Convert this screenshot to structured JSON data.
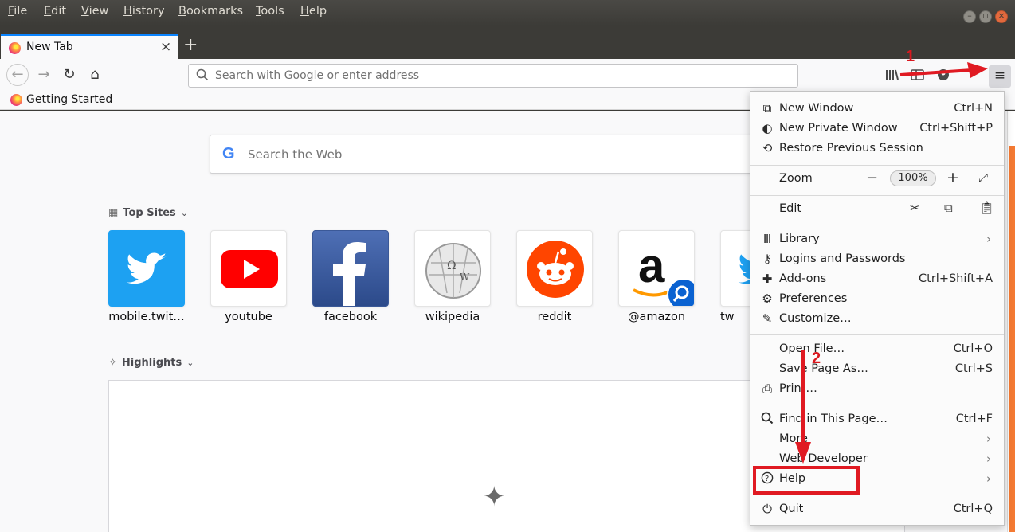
{
  "menubar": {
    "items": [
      "File",
      "Edit",
      "View",
      "History",
      "Bookmarks",
      "Tools",
      "Help"
    ]
  },
  "tab": {
    "title": "New Tab",
    "close": "×",
    "new": "+"
  },
  "nav": {
    "back": "←",
    "forward": "→",
    "reload": "↻",
    "home": "⌂",
    "url_placeholder": "Search with Google or enter address",
    "menu_icon": "≡"
  },
  "bookmarks": {
    "items": [
      "Getting Started"
    ]
  },
  "newtab": {
    "search_placeholder": "Search the Web",
    "google_glyph": "G",
    "top_sites_label": "Top Sites",
    "highlights_label": "Highlights",
    "top_sites": [
      "mobile.twit…",
      "youtube",
      "facebook",
      "wikipedia",
      "reddit",
      "@amazon",
      "tw"
    ]
  },
  "app_menu": {
    "new_window": {
      "label": "New Window",
      "shortcut": "Ctrl+N"
    },
    "new_private_window": {
      "label": "New Private Window",
      "shortcut": "Ctrl+Shift+P"
    },
    "restore_session": {
      "label": "Restore Previous Session"
    },
    "zoom": {
      "label": "Zoom",
      "value": "100%",
      "minus": "−",
      "plus": "+"
    },
    "edit": {
      "label": "Edit"
    },
    "library": {
      "label": "Library"
    },
    "logins": {
      "label": "Logins and Passwords"
    },
    "addons": {
      "label": "Add-ons",
      "shortcut": "Ctrl+Shift+A"
    },
    "preferences": {
      "label": "Preferences"
    },
    "customize": {
      "label": "Customize…"
    },
    "open_file": {
      "label": "Open File…",
      "shortcut": "Ctrl+O"
    },
    "save_page": {
      "label": "Save Page As…",
      "shortcut": "Ctrl+S"
    },
    "print": {
      "label": "Print…"
    },
    "find": {
      "label": "Find in This Page…",
      "shortcut": "Ctrl+F"
    },
    "more": {
      "label": "More"
    },
    "web_developer": {
      "label": "Web Developer"
    },
    "help": {
      "label": "Help"
    },
    "quit": {
      "label": "Quit",
      "shortcut": "Ctrl+Q"
    }
  },
  "annotations": {
    "step1": "1",
    "step2": "2"
  },
  "colors": {
    "annotation_red": "#e01a22",
    "titlebar": "#3c3b37",
    "accent_blue": "#0a84ff",
    "scroll_accent": "#f47a33"
  }
}
